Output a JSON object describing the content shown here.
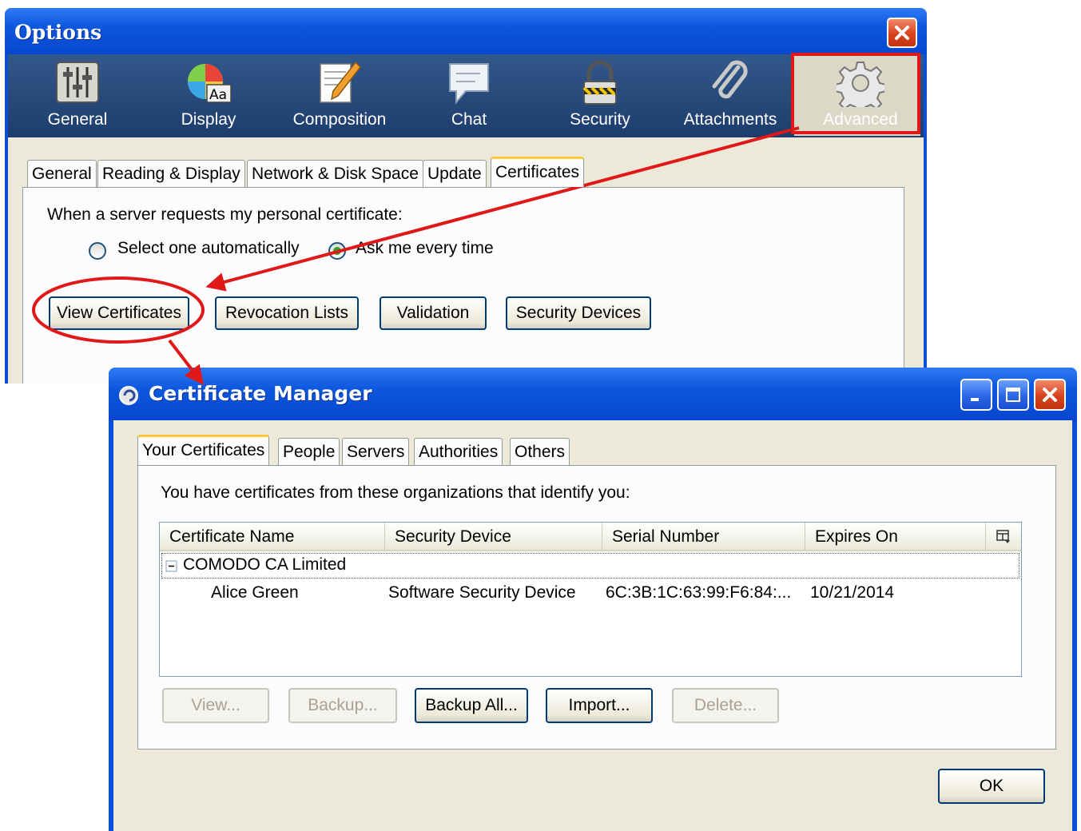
{
  "options_window": {
    "title": "Options",
    "toolbar": [
      {
        "label": "General",
        "icon": "sliders-icon"
      },
      {
        "label": "Display",
        "icon": "color-wheel-icon"
      },
      {
        "label": "Composition",
        "icon": "pencil-paper-icon"
      },
      {
        "label": "Chat",
        "icon": "speech-bubble-icon"
      },
      {
        "label": "Security",
        "icon": "padlock-icon"
      },
      {
        "label": "Attachments",
        "icon": "paperclip-icon"
      },
      {
        "label": "Advanced",
        "icon": "gear-icon"
      }
    ],
    "tabs": [
      "General",
      "Reading & Display",
      "Network & Disk Space",
      "Update",
      "Certificates"
    ],
    "active_tab": "Certificates",
    "prompt": "When a server requests my personal certificate:",
    "radio_auto": "Select one automatically",
    "radio_ask": "Ask me every time",
    "buttons": {
      "view_certificates": "View Certificates",
      "revocation_lists": "Revocation Lists",
      "validation": "Validation",
      "security_devices": "Security Devices"
    }
  },
  "cert_manager": {
    "title": "Certificate Manager",
    "tabs": [
      "Your Certificates",
      "People",
      "Servers",
      "Authorities",
      "Others"
    ],
    "active_tab": "Your Certificates",
    "intro": "You have certificates from these organizations that identify you:",
    "columns": [
      "Certificate Name",
      "Security Device",
      "Serial Number",
      "Expires On"
    ],
    "group": "COMODO CA Limited",
    "rows": [
      {
        "name": "Alice Green",
        "device": "Software Security Device",
        "serial": "6C:3B:1C:63:99:F6:84:...",
        "expires": "10/21/2014"
      }
    ],
    "buttons": {
      "view": "View...",
      "backup": "Backup...",
      "backup_all": "Backup All...",
      "import": "Import...",
      "delete": "Delete..."
    },
    "ok": "OK"
  },
  "colors": {
    "annotation_red": "#e01818",
    "xp_title_blue": "#0d57de",
    "active_tab_accent": "#ffc83c"
  }
}
